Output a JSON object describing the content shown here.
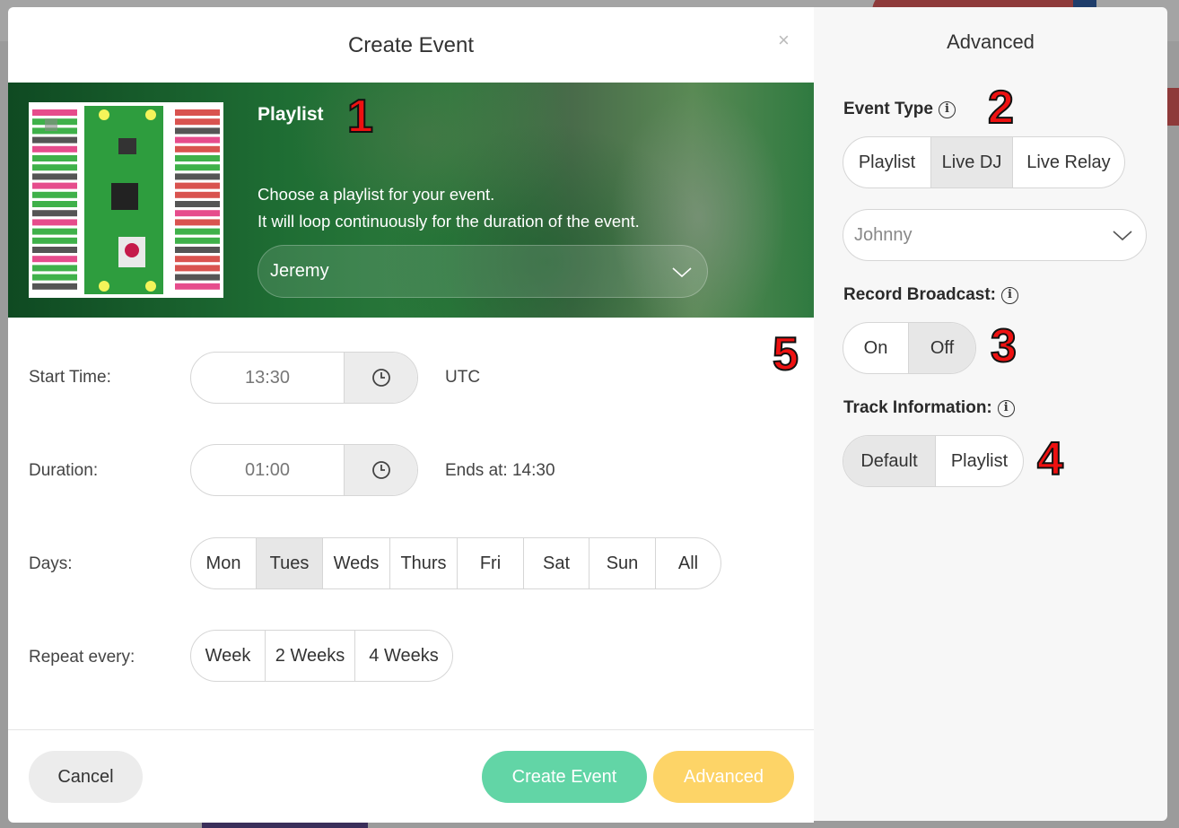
{
  "modal": {
    "title": "Create Event",
    "close_label": "×",
    "hero": {
      "heading": "Playlist",
      "description_line1": "Choose a playlist for your event.",
      "description_line2": "It will loop continuously for the duration of the event.",
      "playlist_selected": "Jeremy"
    },
    "start_time": {
      "label": "Start Time:",
      "value": "13:30",
      "timezone": "UTC"
    },
    "duration": {
      "label": "Duration:",
      "value": "01:00",
      "ends_at": "Ends at: 14:30"
    },
    "days": {
      "label": "Days:",
      "options": [
        "Mon",
        "Tues",
        "Weds",
        "Thurs",
        "Fri",
        "Sat",
        "Sun",
        "All"
      ],
      "selected": "Tues"
    },
    "repeat": {
      "label": "Repeat every:",
      "options": [
        "Week",
        "2 Weeks",
        "4 Weeks"
      ]
    },
    "buttons": {
      "cancel": "Cancel",
      "create": "Create Event",
      "advanced": "Advanced"
    }
  },
  "advanced_panel": {
    "title": "Advanced",
    "event_type": {
      "label": "Event Type",
      "options": [
        "Playlist",
        "Live DJ",
        "Live Relay"
      ],
      "selected": "Live DJ"
    },
    "dj_select_value": "Johnny",
    "record_broadcast": {
      "label": "Record Broadcast:",
      "options": [
        "On",
        "Off"
      ],
      "selected": "Off"
    },
    "track_information": {
      "label": "Track Information:",
      "options": [
        "Default",
        "Playlist"
      ],
      "selected": "Default"
    }
  },
  "annotations": [
    "1",
    "2",
    "3",
    "4",
    "5"
  ],
  "colors": {
    "create_button": "#62d5a6",
    "advanced_button": "#fdd467",
    "annotation_red": "#ee1111",
    "selected_segment": "#e7e7e7"
  },
  "icons": [
    "close-icon",
    "clock-icon",
    "chevron-down-icon",
    "info-icon"
  ]
}
